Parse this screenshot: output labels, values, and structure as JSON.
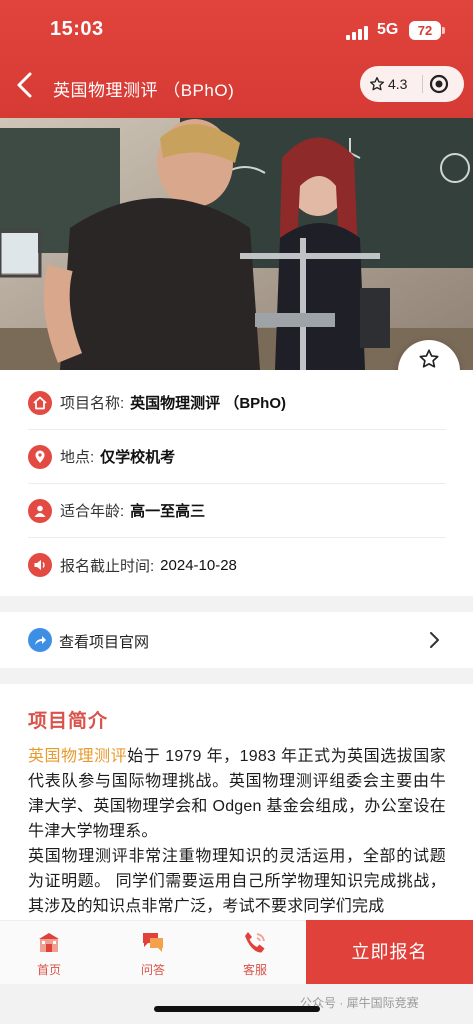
{
  "status_bar": {
    "time": "15:03",
    "network": "5G",
    "battery": "72"
  },
  "header": {
    "title": "英国物理测评 （BPhO)",
    "rating": "4.3"
  },
  "favorite_label": "收藏",
  "info": [
    {
      "icon": "home-icon",
      "label": "项目名称:",
      "value": "英国物理测评 （BPhO)"
    },
    {
      "icon": "location-pin-icon",
      "label": "地点:",
      "value": "仅学校机考"
    },
    {
      "icon": "person-icon",
      "label": "适合年龄:",
      "value": "高一至高三"
    },
    {
      "icon": "speaker-icon",
      "label": "报名截止时间:",
      "value": "2024-10-28"
    }
  ],
  "website_link": "查看项目官网",
  "intro": {
    "heading": "项目简介",
    "highlight": "英国物理测评",
    "p1_rest": "始于 1979 年，1983 年正式为英国选拔国家代表队参与国际物理挑战。英国物理测评组委会主要由牛津大学、英国物理学会和 Odgen 基金会组成，办公室设在牛津大学物理系。",
    "p2": "英国物理测评非常注重物理知识的灵活运用，全部的试题为证明题。 同学们需要运用自己所学物理知识完成挑战，其涉及的知识点非常广泛，考试不要求同学们完成"
  },
  "tabs": [
    {
      "icon": "school-icon",
      "label": "首页"
    },
    {
      "icon": "chat-bubble-icon",
      "label": "问答"
    },
    {
      "icon": "phone-icon",
      "label": "客服"
    }
  ],
  "apply_button": "立即报名",
  "watermark": "公众号 · 犀牛国际竞赛",
  "colors": {
    "brand_red": "#e0413b",
    "title_red": "#d9534a",
    "highlight_orange": "#e79a2e",
    "link_blue": "#3d8fe6"
  }
}
